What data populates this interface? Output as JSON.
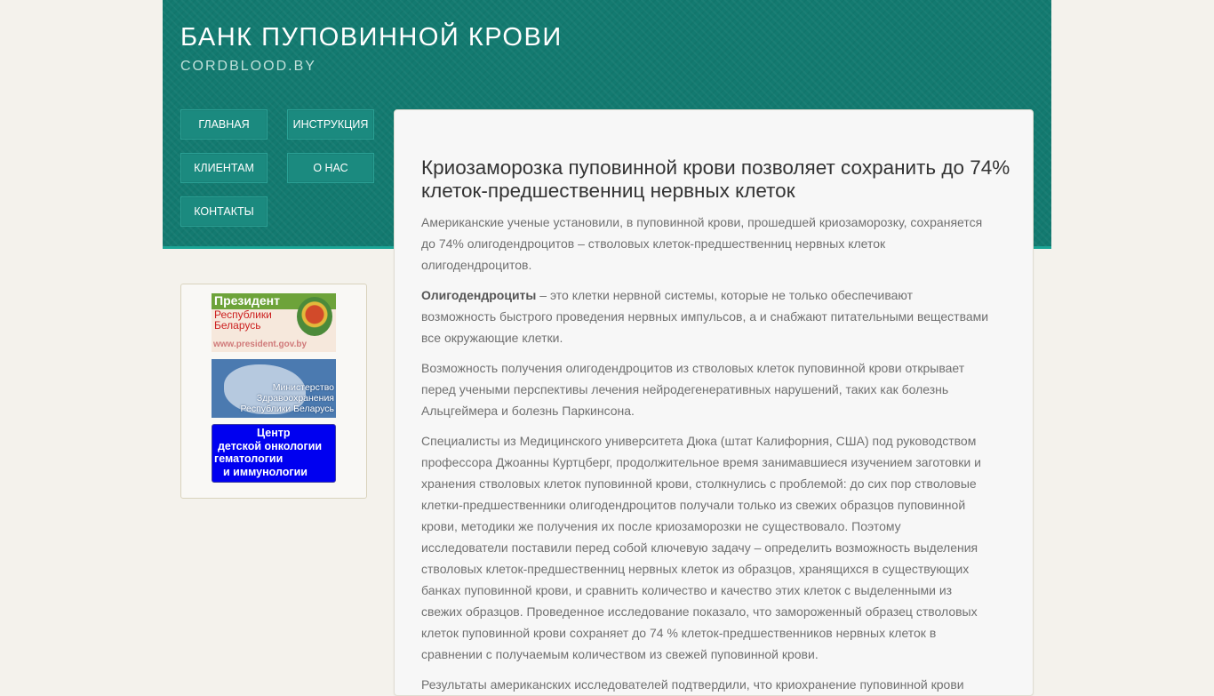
{
  "header": {
    "title": "БАНК ПУПОВИННОЙ КРОВИ",
    "subtitle": "CORDBLOOD.BY"
  },
  "nav": {
    "home": "ГЛАВНАЯ",
    "instruction": "ИНСТРУКЦИЯ",
    "clients": "КЛИЕНТАМ",
    "about": "О НАС",
    "contacts": "КОНТАКТЫ"
  },
  "sidebar": {
    "president": {
      "line1": "Президент",
      "line2": "Республики",
      "line3": "Беларусь",
      "url": "www.president.gov.by"
    },
    "ministry": {
      "line1": "Министерство",
      "line2": "Здравоохранения",
      "line3": "Республики Беларусь"
    },
    "oncology": {
      "line1": "Центр",
      "line2": "детской онкологии",
      "line3": "гематологии",
      "line4": "и иммунологии"
    }
  },
  "article": {
    "title": "Криозаморозка пуповинной крови позволяет сохранить до 74% клеток-предшественниц нервных клеток",
    "p1": "Американские ученые установили, в пуповинной крови, прошедшей криозаморозку, сохраняется до 74% олигодендроцитов – стволовых клеток-предшественниц нервных клеток олигодендроцитов.",
    "p2_bold": "Олигодендроциты",
    "p2_rest": " – это клетки нервной системы, которые не только обеспечивают возможность быстрого проведения нервных импульсов, а и снабжают питательными веществами все окружающие клетки.",
    "p3": "Возможность получения олигодендроцитов из стволовых клеток пуповинной крови открывает перед учеными перспективы лечения нейродегенеративных нарушений, таких как болезнь Альцгеймера и болезнь Паркинсона.",
    "p4": "Специалисты из Медицинского университета Дюка (штат Калифорния, США) под руководством профессора Джоанны Куртцберг, продолжительное время занимавшиеся изучением заготовки и хранения стволовых клеток пуповинной крови, столкнулись с проблемой: до сих пор стволовые клетки-предшественники олигодендроцитов получали только из свежих образцов пуповинной крови, методики же получения их после криозаморозки не существовало. Поэтому исследователи поставили перед собой ключевую задачу – определить возможность выделения стволовых клеток-предшественниц нервных клеток из образцов, хранящихся в существующих банках пуповинной крови, и сравнить количество и качество этих клеток с выделенными из свежих образцов. Проведенное исследование показало, что замороженный образец стволовых клеток пуповинной крови сохраняет до 74 % клеток-предшественников нервных клеток в сравнении с получаемым количеством из свежей пуповинной крови.",
    "p5": "Результаты американских исследователей подтвердили, что криохранение пуповинной крови"
  },
  "colors": {
    "header_bg": "#137a70",
    "nav_button": "#1b8a7f",
    "page_bg": "#f4f2ec",
    "oncology_banner": "#0000f0"
  }
}
